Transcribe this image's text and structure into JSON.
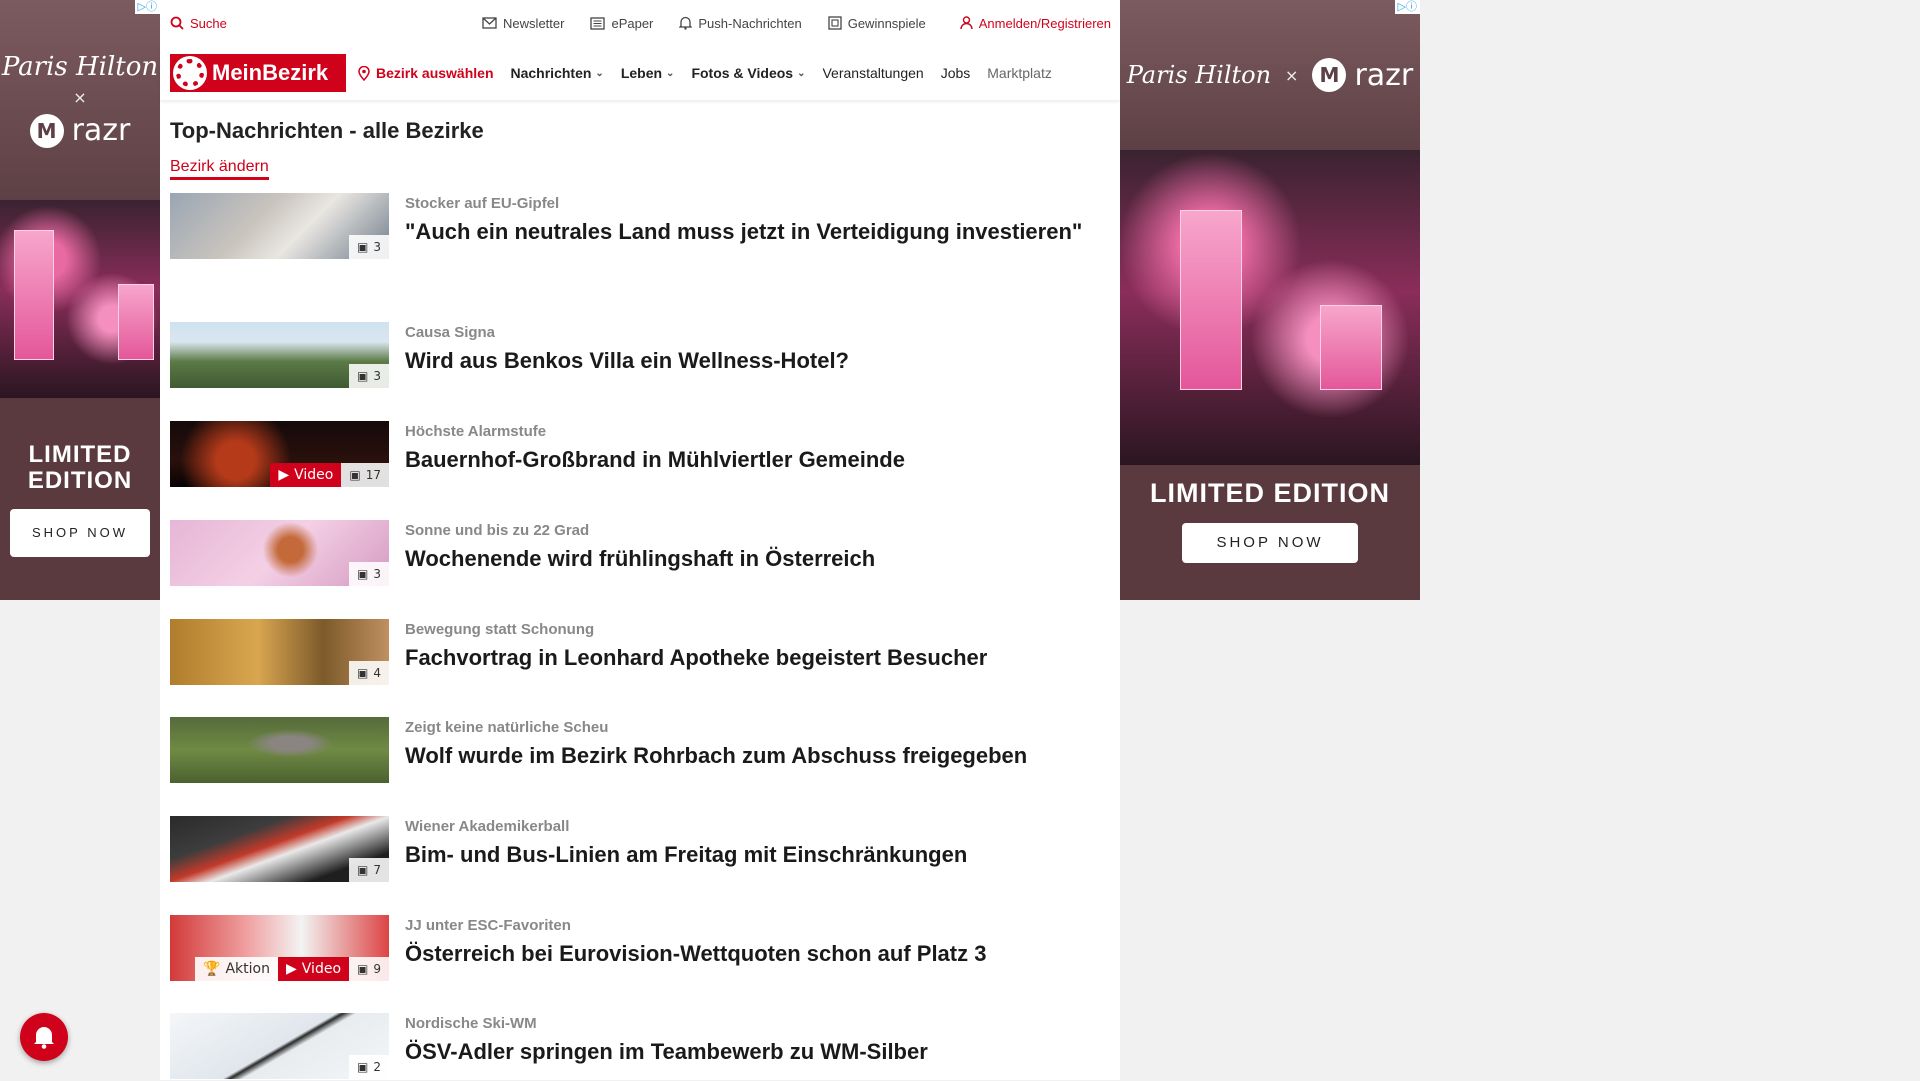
{
  "topbar": {
    "search_label": "Suche",
    "newsletter_label": "Newsletter",
    "epaper_label": "ePaper",
    "push_label": "Push-Nachrichten",
    "gewinnspiele_label": "Gewinnspiele",
    "login_label": "Anmelden/Registrieren"
  },
  "nav": {
    "logo_text": "MeinBezirk",
    "bezirk_label": "Bezirk auswählen",
    "items": [
      "Nachrichten",
      "Leben",
      "Fotos & Videos",
      "Veranstaltungen",
      "Jobs",
      "Marktplatz"
    ]
  },
  "main": {
    "title": "Top-Nachrichten - alle Bezirke",
    "change_link": "Bezirk ändern",
    "articles": [
      {
        "kicker": "Stocker auf EU-Gipfel",
        "headline": "\"Auch ein neutrales Land muss jetzt in Verteidigung investieren\"",
        "count": "3"
      },
      {
        "kicker": "Causa Signa",
        "headline": "Wird aus Benkos Villa ein Wellness-Hotel?",
        "count": "3"
      },
      {
        "kicker": "Höchste Alarmstufe",
        "headline": "Bauernhof-Großbrand in Mühlviertler Gemeinde",
        "count": "17",
        "video": "Video"
      },
      {
        "kicker": "Sonne und bis zu 22 Grad",
        "headline": "Wochenende wird frühlingshaft in Österreich",
        "count": "3"
      },
      {
        "kicker": "Bewegung statt Schonung",
        "headline": "Fachvortrag in Leonhard Apotheke begeistert Besucher",
        "count": "4"
      },
      {
        "kicker": "Zeigt keine natürliche Scheu",
        "headline": "Wolf wurde im Bezirk Rohrbach zum Abschuss freigegeben"
      },
      {
        "kicker": "Wiener Akademikerball",
        "headline": "Bim- und Bus-Linien am Freitag mit Einschränkungen",
        "count": "7"
      },
      {
        "kicker": "JJ unter ESC-Favoriten",
        "headline": "Österreich bei Eurovision-Wettquoten schon auf Platz 3",
        "count": "9",
        "video": "Video",
        "aktion": "Aktion"
      },
      {
        "kicker": "Nordische Ski-WM",
        "headline": "ÖSV-Adler springen im Teambewerb zu WM-Silber",
        "count": "2"
      }
    ]
  },
  "ads": {
    "left": {
      "brand_script": "Paris Hilton",
      "x": "×",
      "product": "razr",
      "limited": "LIMITED EDITION",
      "cta": "SHOP NOW"
    },
    "right": {
      "brand_script": "Paris Hilton",
      "x": "×",
      "product": "razr",
      "limited": "LIMITED EDITION",
      "cta": "SHOP NOW"
    }
  },
  "colors": {
    "accent": "#d0021b",
    "ad_bg": "#6b4a4e"
  }
}
